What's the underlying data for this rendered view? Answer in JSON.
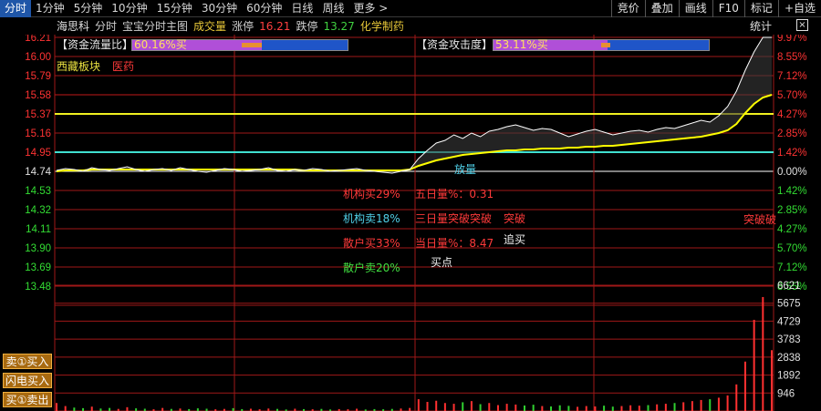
{
  "tabs": [
    {
      "label": "分时",
      "active": true
    },
    {
      "label": "1分钟"
    },
    {
      "label": "5分钟"
    },
    {
      "label": "10分钟"
    },
    {
      "label": "15分钟"
    },
    {
      "label": "30分钟"
    },
    {
      "label": "60分钟"
    },
    {
      "label": "日线"
    },
    {
      "label": "周线"
    },
    {
      "label": "更多 >"
    }
  ],
  "right_buttons": [
    {
      "label": "竞价"
    },
    {
      "label": "叠加"
    },
    {
      "label": "画线"
    },
    {
      "label": "F10"
    },
    {
      "label": "标记"
    },
    {
      "label": "+自选"
    }
  ],
  "info": {
    "name": "海思科",
    "type": "分时",
    "template": "宝宝分时主图",
    "volume": "成交量",
    "limit_up_label": "涨停",
    "limit_up": "16.21",
    "limit_down_label": "跌停",
    "limit_down": "13.27",
    "industry": "化学制药",
    "stats": "统计",
    "close": "×"
  },
  "colors": {
    "grid_red": "#a01818",
    "price_line": "#ffffff",
    "avg_line": "#ffff00",
    "ref_line_cyan": "#40e0d0",
    "up_text": "#ff3333",
    "down_text": "#33dd33",
    "flag_bar": "#1f55c8",
    "flag_fill": "#b04fd8"
  },
  "price_axis": [
    "16.21",
    "16.00",
    "15.79",
    "15.58",
    "15.37",
    "15.16",
    "14.95",
    "14.74",
    "14.53",
    "14.32",
    "14.11",
    "13.90",
    "13.69",
    "13.48"
  ],
  "pct_axis": [
    "9.97%",
    "8.55%",
    "7.12%",
    "5.70%",
    "4.27%",
    "2.85%",
    "1.42%",
    "0.00%",
    "1.42%",
    "2.85%",
    "4.27%",
    "5.70%",
    "7.12%",
    "8.55%"
  ],
  "vol_axis": [
    "6621",
    "5675",
    "4729",
    "3783",
    "2838",
    "1892",
    "946"
  ],
  "flags": {
    "fund_flow_label": "【资金流量比】",
    "fund_flow_value": "60.16%买",
    "fund_flow_ratio": 0.6016,
    "attack_label": "【资金攻击度】",
    "attack_value": "53.11%买",
    "attack_ratio": 0.5311
  },
  "sector": {
    "label": "西藏板块",
    "industry": "医药"
  },
  "overlays": {
    "inst_buy": "机构买29%",
    "inst_sell": "机构卖18%",
    "retail_buy": "散户买33%",
    "retail_sell": "散户卖20%",
    "five_day": "五日量%：0.31",
    "three_day": "三日量突破突破",
    "today": "当日量%：8.47",
    "breakout": "突破",
    "chase": "追买",
    "buy_point": "买点",
    "breakout_right": "突破破",
    "volume_up": "放量"
  },
  "side_buttons": [
    {
      "label": "卖①买入"
    },
    {
      "label": "闪电买入"
    },
    {
      "label": "买①卖出"
    }
  ],
  "chart_data": {
    "type": "line",
    "reference_price": 14.74,
    "price_range": [
      13.27,
      16.21
    ],
    "price_series": [
      14.75,
      14.77,
      14.76,
      14.74,
      14.78,
      14.76,
      14.75,
      14.77,
      14.79,
      14.76,
      14.74,
      14.76,
      14.77,
      14.75,
      14.78,
      14.76,
      14.74,
      14.73,
      14.75,
      14.77,
      14.76,
      14.74,
      14.75,
      14.76,
      14.78,
      14.75,
      14.74,
      14.76,
      14.75,
      14.77,
      14.76,
      14.74,
      14.75,
      14.76,
      14.77,
      14.75,
      14.74,
      14.73,
      14.72,
      14.74,
      14.76,
      14.88,
      14.97,
      15.05,
      15.08,
      15.14,
      15.1,
      15.16,
      15.12,
      15.18,
      15.2,
      15.23,
      15.25,
      15.22,
      15.19,
      15.21,
      15.2,
      15.16,
      15.12,
      15.15,
      15.18,
      15.2,
      15.17,
      15.14,
      15.16,
      15.18,
      15.19,
      15.17,
      15.2,
      15.22,
      15.21,
      15.24,
      15.27,
      15.3,
      15.28,
      15.35,
      15.45,
      15.62,
      15.85,
      16.05,
      16.21,
      16.21
    ],
    "avg_series": [
      14.74,
      14.75,
      14.75,
      14.75,
      14.76,
      14.76,
      14.76,
      14.76,
      14.76,
      14.76,
      14.76,
      14.76,
      14.76,
      14.76,
      14.76,
      14.76,
      14.76,
      14.76,
      14.76,
      14.76,
      14.76,
      14.76,
      14.76,
      14.76,
      14.76,
      14.76,
      14.76,
      14.76,
      14.75,
      14.75,
      14.75,
      14.75,
      14.75,
      14.75,
      14.75,
      14.75,
      14.75,
      14.75,
      14.75,
      14.75,
      14.76,
      14.8,
      14.83,
      14.86,
      14.88,
      14.9,
      14.92,
      14.93,
      14.94,
      14.95,
      14.96,
      14.97,
      14.97,
      14.98,
      14.98,
      14.99,
      14.99,
      14.99,
      15.0,
      15.0,
      15.01,
      15.01,
      15.02,
      15.02,
      15.03,
      15.04,
      15.05,
      15.06,
      15.07,
      15.08,
      15.09,
      15.1,
      15.11,
      15.12,
      15.14,
      15.16,
      15.19,
      15.26,
      15.38,
      15.48,
      15.55,
      15.58
    ],
    "volume_range": [
      0,
      6621
    ],
    "volume_series": [
      420,
      260,
      180,
      150,
      230,
      130,
      160,
      110,
      200,
      140,
      120,
      90,
      160,
      110,
      130,
      100,
      140,
      120,
      90,
      110,
      150,
      100,
      120,
      90,
      130,
      110,
      80,
      120,
      100,
      90,
      110,
      80,
      100,
      90,
      120,
      80,
      100,
      90,
      110,
      130,
      160,
      620,
      480,
      540,
      420,
      380,
      460,
      520,
      360,
      420,
      310,
      380,
      340,
      290,
      330,
      260,
      240,
      300,
      270,
      220,
      260,
      240,
      280,
      230,
      260,
      300,
      280,
      310,
      350,
      380,
      420,
      460,
      520,
      580,
      620,
      700,
      820,
      1400,
      2600,
      4800,
      6000,
      3200
    ]
  }
}
